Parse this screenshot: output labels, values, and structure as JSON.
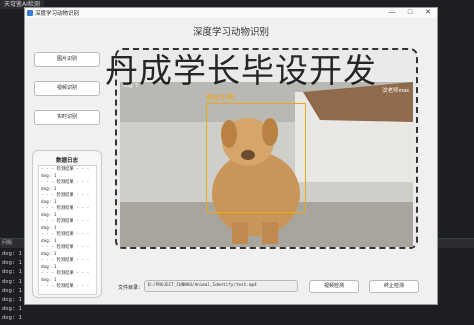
{
  "ide": {
    "tab_label": "天穹鉴AI检测",
    "bottom_label": "问题",
    "console_lines": [
      "dog: 1",
      "dog: 1",
      "dog: 1",
      "dog: 1",
      "dog: 1",
      "dog: 1",
      "dog: 1",
      "dog: 1"
    ]
  },
  "window": {
    "title": "深度学习动物识别",
    "controls": [
      "—",
      "□",
      "✕"
    ]
  },
  "app": {
    "title": "深度学习动物识别",
    "banner": "丹成学长毕设开发",
    "side_buttons": [
      "图片识别",
      "视频识别",
      "实时识别"
    ],
    "log": {
      "title": "数据日志",
      "lines": [
        "- - - 检测结果 - - -",
        "dog: 1",
        "- - - 检测结果 - - -",
        "dog: 1",
        "- - - 检测结果 - - -",
        "dog: 1",
        "- - - 检测结果 - - -",
        "dog: 1",
        "- - - 检测结果 - - -",
        "dog: 1",
        "- - - 检测结果 - - -",
        "dog: 1",
        "- - - 检测结果 - - -",
        "dog: 1",
        "- - - 检测结果 - - -",
        "dog: 1",
        "- - - 检测结果 - - -",
        "dog: 1",
        "- - - 检测结果 - - -"
      ]
    },
    "video": {
      "count_label": "dog: 1",
      "watermark": "汶老师max",
      "detection_label": "dog  0.90",
      "box_color": "#f2a51c"
    },
    "file": {
      "label": "文件目录：",
      "path": "D:/PROJECT_CUNNAO/Animal_Identify/test.mp4"
    },
    "actions": {
      "detect": "视频检测",
      "stop": "终止检测"
    }
  }
}
